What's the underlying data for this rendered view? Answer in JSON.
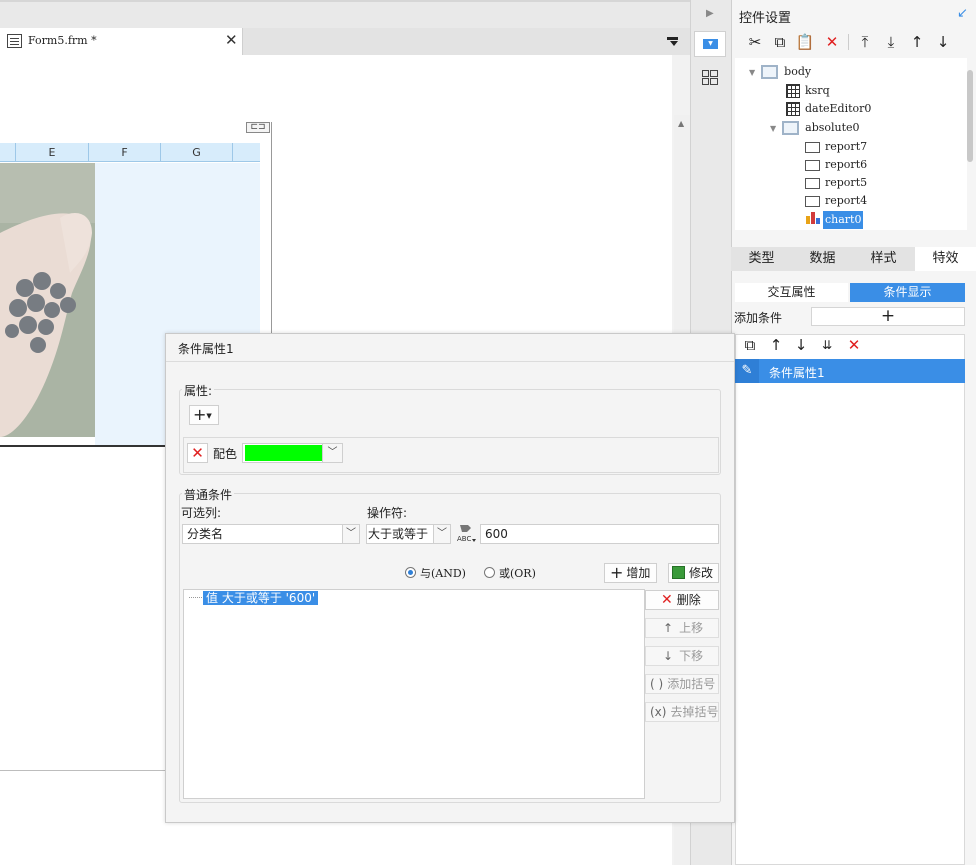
{
  "editor": {
    "tab_title": "Form5.frm *",
    "columns": [
      "E",
      "F",
      "G"
    ]
  },
  "panel": {
    "title": "控件设置",
    "tree": [
      {
        "label": "body",
        "kind": "frame"
      },
      {
        "label": "ksrq",
        "kind": "date"
      },
      {
        "label": "dateEditor0",
        "kind": "date"
      },
      {
        "label": "absolute0",
        "kind": "frame"
      },
      {
        "label": "report7",
        "kind": "report"
      },
      {
        "label": "report6",
        "kind": "report"
      },
      {
        "label": "report5",
        "kind": "report"
      },
      {
        "label": "report4",
        "kind": "report"
      },
      {
        "label": "chart0",
        "kind": "chart",
        "selected": true
      }
    ],
    "tabs": [
      "类型",
      "数据",
      "样式",
      "特效"
    ],
    "active_tab": "特效",
    "subtabs": [
      "交互属性",
      "条件显示"
    ],
    "active_subtab": "条件显示",
    "add_condition_label": "添加条件",
    "condition_items": [
      "条件属性1"
    ]
  },
  "dialog": {
    "title": "条件属性1",
    "attribute_group_label": "属性:",
    "color_label": "配色",
    "color_value": "#00ff00",
    "common_group_label": "普通条件",
    "column_label": "可选列:",
    "column_value": "分类名",
    "operator_label": "操作符:",
    "operator_value": "大于或等于",
    "value": "600",
    "and_label": "与(AND)",
    "or_label": "或(OR)",
    "and_selected": true,
    "add_button": "增加",
    "edit_button": "修改",
    "condition_text": "值 大于或等于 '600'",
    "delete_button": "删除",
    "move_up_button": "上移",
    "move_down_button": "下移",
    "add_bracket_button": "添加括号",
    "remove_bracket_button": "去掉括号"
  },
  "colors": {
    "accent": "#3a8ee6",
    "delete_red": "#e02020",
    "column_header": "#d7ecfb"
  }
}
